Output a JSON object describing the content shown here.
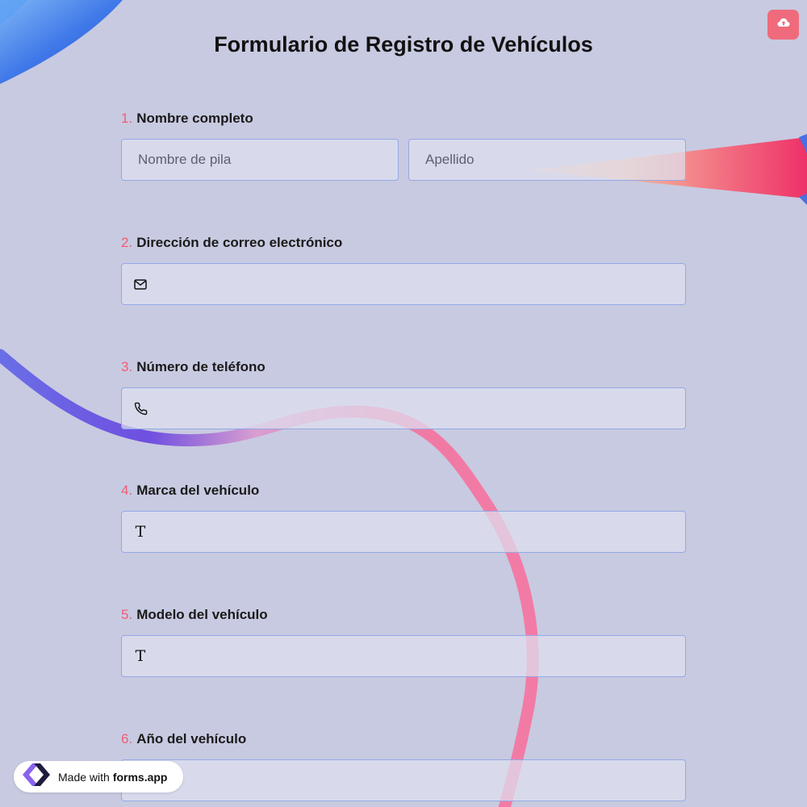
{
  "form": {
    "title": "Formulario de Registro de Vehículos"
  },
  "questions": [
    {
      "number": "1.",
      "label": "Nombre completo",
      "first_name_placeholder": "Nombre de pila",
      "last_name_placeholder": "Apellido"
    },
    {
      "number": "2.",
      "label": "Dirección de correo electrónico",
      "icon": "envelope-icon",
      "value": ""
    },
    {
      "number": "3.",
      "label": "Número de teléfono",
      "icon": "phone-icon",
      "value": ""
    },
    {
      "number": "4.",
      "label": "Marca del vehículo",
      "icon": "text-icon",
      "icon_glyph": "T",
      "value": ""
    },
    {
      "number": "5.",
      "label": "Modelo del vehículo",
      "icon": "text-icon",
      "icon_glyph": "T",
      "value": ""
    },
    {
      "number": "6.",
      "label": "Año del vehículo",
      "value": ""
    }
  ],
  "upload_button": {
    "icon": "cloud-upload-icon"
  },
  "badge": {
    "prefix": "Made with",
    "brand": "forms.app",
    "icon": "forms-app-logo-icon"
  },
  "colors": {
    "background": "#c8cae1",
    "accent": "#ef6b7c",
    "question_number": "#ef5d74",
    "field_border": "#93a9e3",
    "field_fill": "#dee1f0"
  }
}
